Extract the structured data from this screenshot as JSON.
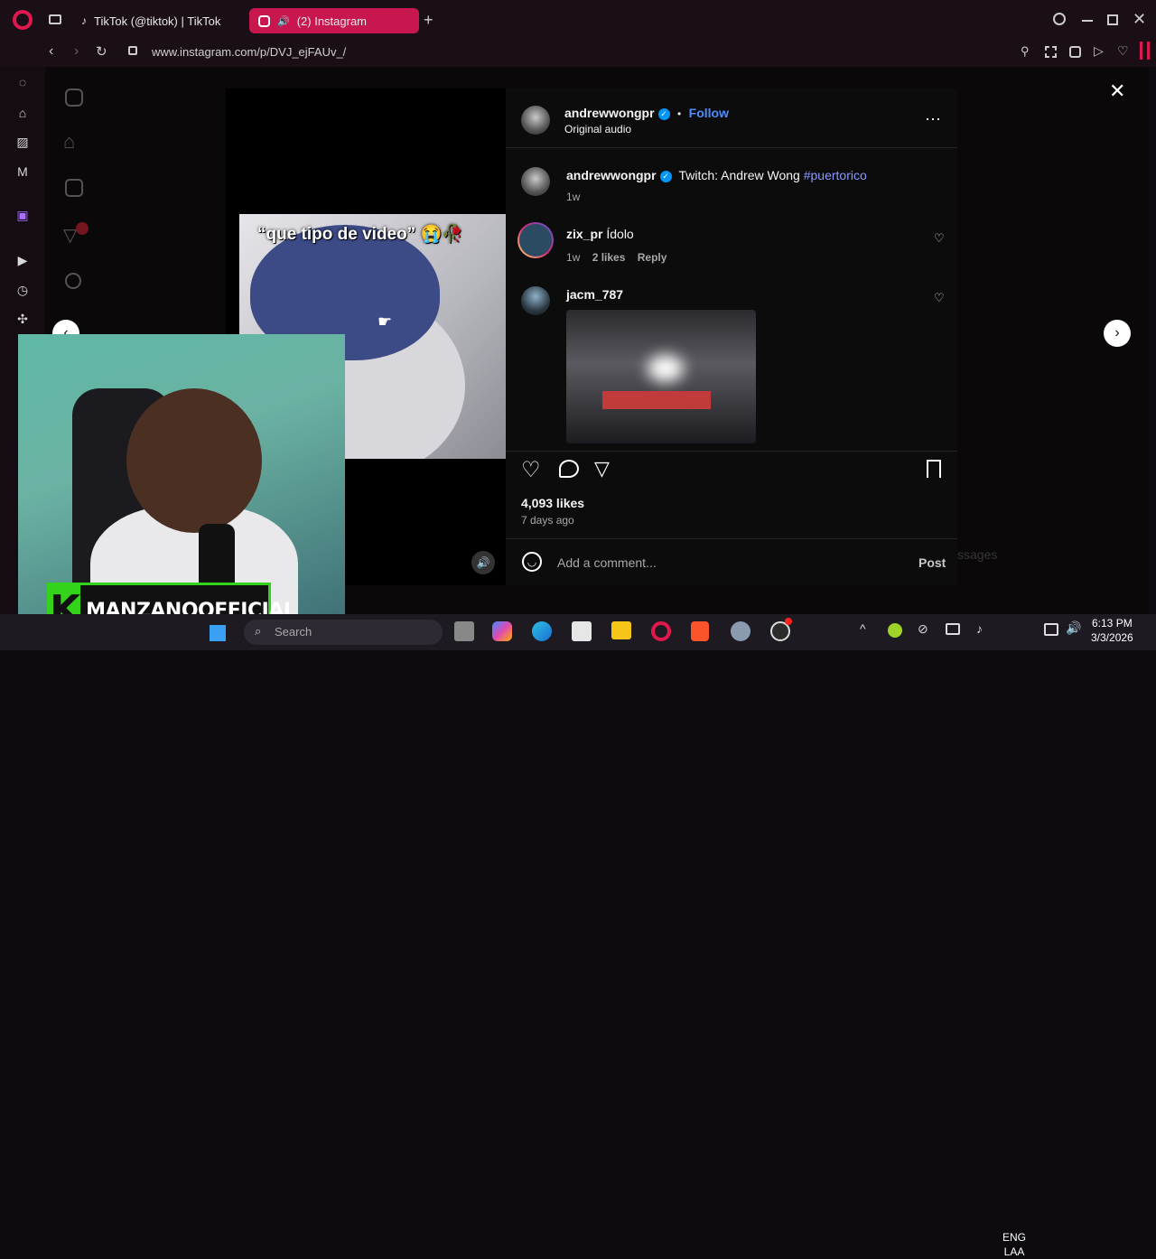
{
  "browser": {
    "tabs": [
      {
        "label": "TikTok (@tiktok) | TikTok"
      },
      {
        "label": "(2) Instagram"
      }
    ],
    "url": "www.instagram.com/p/DVJ_ejFAUv_/"
  },
  "post": {
    "author": "andrewwongpr",
    "follow_label": "Follow",
    "separator": "•",
    "audio": "Original audio",
    "caption_author": "andrewwongpr",
    "caption_text": "Twitch: Andrew Wong",
    "caption_hashtag": "#puertorico",
    "caption_time": "1w",
    "video_overlay_text": "“que tipo de video” 😭🥀",
    "likes": "4,093 likes",
    "posted": "7 days ago",
    "comment_placeholder": "Add a comment...",
    "post_label": "Post"
  },
  "comments": [
    {
      "user": "zix_pr",
      "text": "Ídolo",
      "time": "1w",
      "likes": "2 likes",
      "reply": "Reply"
    },
    {
      "user": "jacm_787",
      "text": "",
      "gif": true
    }
  ],
  "overlay_brand": {
    "letter": "K",
    "text": "MANZANOOFFICIAL"
  },
  "background_fragment": "ssages",
  "taskbar": {
    "search_placeholder": "Search",
    "language": [
      "ENG",
      "LAA"
    ],
    "time": "6:13 PM",
    "date": "3/3/2026"
  },
  "colors": {
    "active_tab": "#c8174f",
    "follow": "#4f8cff",
    "hashtag": "#8899ff",
    "brand_green": "#34d31b"
  }
}
